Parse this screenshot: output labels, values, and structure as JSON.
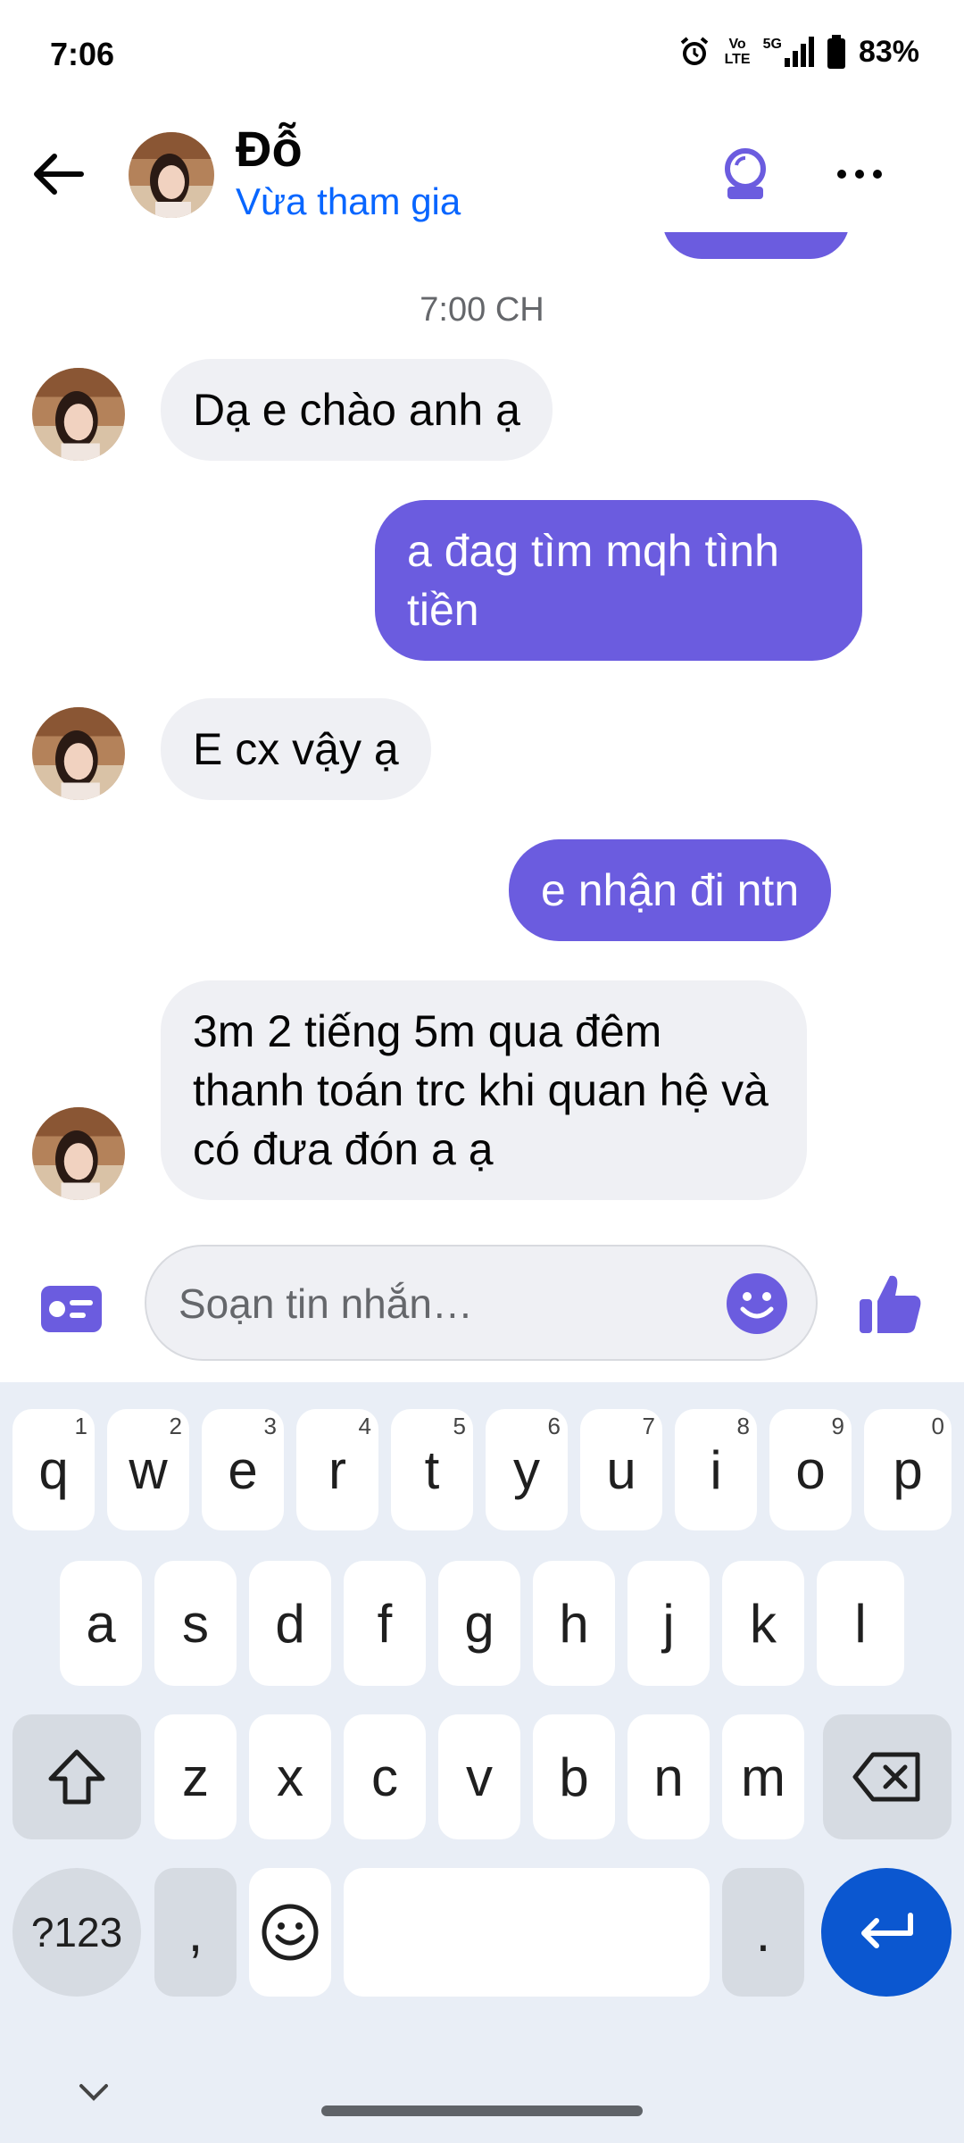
{
  "status_bar": {
    "time": "7:06",
    "network_volte_top": "Vo",
    "network_volte_bottom": "LTE",
    "network_type": "5G",
    "battery_percent": "83%",
    "battery_level": 0.83
  },
  "header": {
    "contact_name": "Đỗ",
    "contact_status": "Vừa tham gia",
    "accent_color": "#6b5cdf",
    "status_color": "#0866ff"
  },
  "chat": {
    "timestamp": "7:00 CH",
    "messages": [
      {
        "direction": "in",
        "text": "Dạ e chào anh ạ"
      },
      {
        "direction": "out",
        "text": "a đag tìm mqh tình tiền"
      },
      {
        "direction": "in",
        "text": "E cx vậy ạ"
      },
      {
        "direction": "out",
        "text": "e nhận đi ntn"
      },
      {
        "direction": "in",
        "text": "3m 2 tiếng 5m qua đêm thanh toán trc khi quan hệ và có đưa đón a ạ"
      }
    ]
  },
  "composer": {
    "placeholder": "Soạn tin nhắn…",
    "value": ""
  },
  "keyboard": {
    "row1": [
      {
        "key": "q",
        "hint": "1"
      },
      {
        "key": "w",
        "hint": "2"
      },
      {
        "key": "e",
        "hint": "3"
      },
      {
        "key": "r",
        "hint": "4"
      },
      {
        "key": "t",
        "hint": "5"
      },
      {
        "key": "y",
        "hint": "6"
      },
      {
        "key": "u",
        "hint": "7"
      },
      {
        "key": "i",
        "hint": "8"
      },
      {
        "key": "o",
        "hint": "9"
      },
      {
        "key": "p",
        "hint": "0"
      }
    ],
    "row2": [
      "a",
      "s",
      "d",
      "f",
      "g",
      "h",
      "j",
      "k",
      "l"
    ],
    "row3": [
      "z",
      "x",
      "c",
      "v",
      "b",
      "n",
      "m"
    ],
    "symbols_label": "?123",
    "comma_label": ",",
    "period_label": ".",
    "enter_color": "#0b57d0"
  }
}
